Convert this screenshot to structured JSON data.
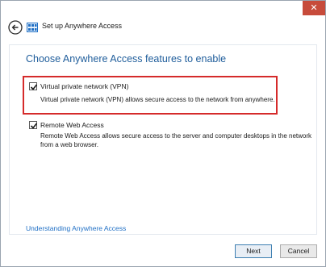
{
  "window": {
    "title": "Set up Anywhere Access",
    "close_label": "✕"
  },
  "main": {
    "heading": "Choose Anywhere Access features to enable",
    "options": [
      {
        "label": "Virtual private network (VPN)",
        "description": "Virtual private network (VPN) allows secure access to the network from anywhere.",
        "checked": true
      },
      {
        "label": "Remote Web Access",
        "description_line1": "Remote Web Access allows secure access to the server and computer desktops in the network",
        "description_line2": "from a web browser.",
        "checked": true
      }
    ],
    "link": "Understanding Anywhere Access"
  },
  "buttons": {
    "next": "Next",
    "cancel": "Cancel"
  },
  "colors": {
    "heading": "#1f5d9b",
    "highlight": "#d52b2b",
    "link": "#1f6fc5",
    "close": "#c74b3b"
  }
}
